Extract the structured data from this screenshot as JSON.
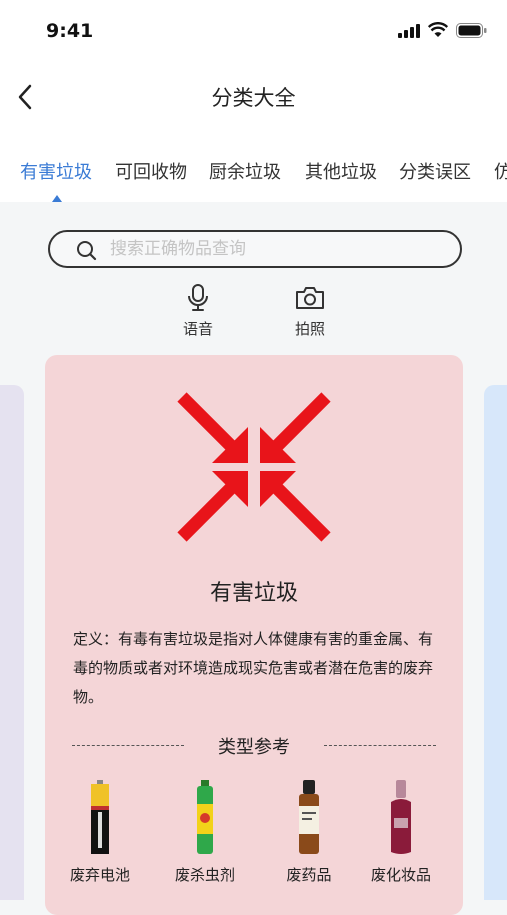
{
  "status_bar": {
    "time": "9:41"
  },
  "nav": {
    "title": "分类大全"
  },
  "tabs": [
    "有害垃圾",
    "可回收物",
    "厨余垃圾",
    "其他垃圾",
    "分类误区",
    "仿"
  ],
  "search": {
    "placeholder": "搜索正确物品查询"
  },
  "tools": {
    "voice_label": "语音",
    "photo_label": "拍照"
  },
  "card": {
    "title": "有害垃圾",
    "definition": "定义：有毒有害垃圾是指对人体健康有害的重金属、有毒的物质或者对环境造成现实危害或者潜在危害的废弃物。",
    "reference_title": "类型参考",
    "items": [
      {
        "label": "废弃电池",
        "icon": "battery-icon"
      },
      {
        "label": "废杀虫剂",
        "icon": "insecticide-icon"
      },
      {
        "label": "废药品",
        "icon": "medicine-bottle-icon"
      },
      {
        "label": "废化妆品",
        "icon": "cosmetics-icon"
      }
    ]
  },
  "colors": {
    "accent": "#3a7bd5",
    "hazard_red": "#e8141a",
    "card_bg": "#f4d5d7"
  }
}
